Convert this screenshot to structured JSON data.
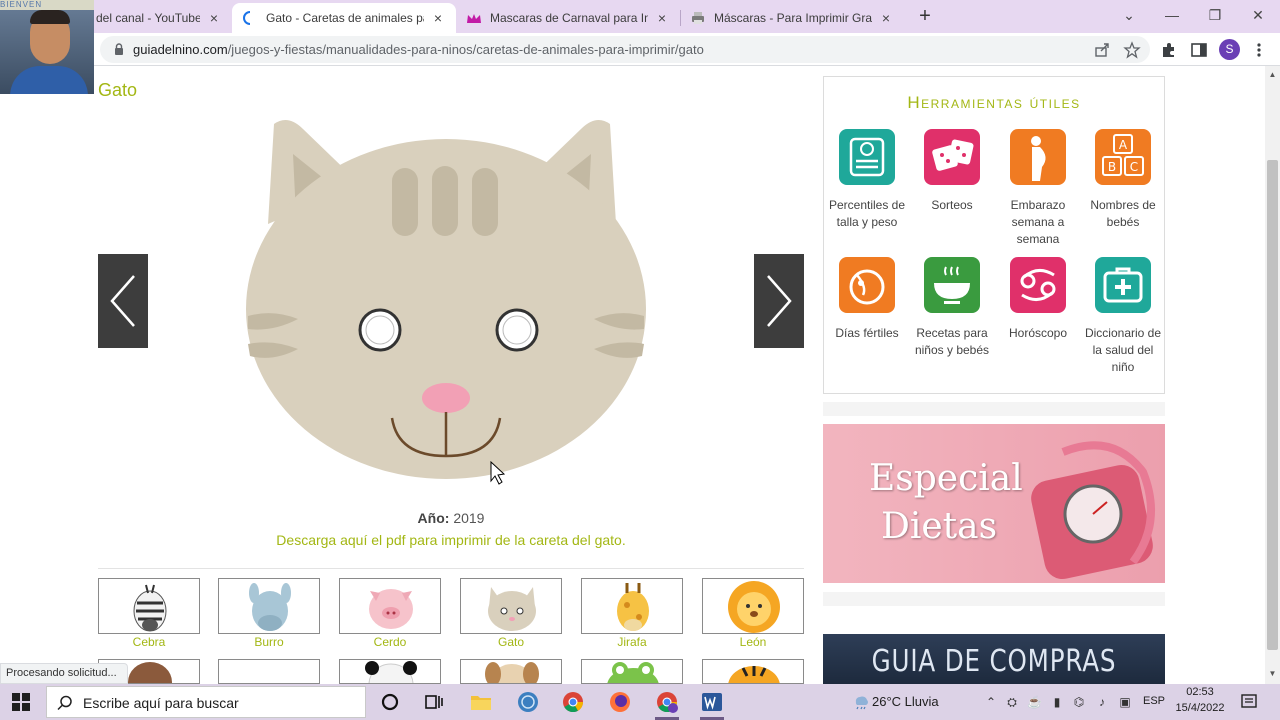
{
  "tabs": [
    {
      "title": "del canal - YouTube St",
      "active": false
    },
    {
      "title": "Gato - Caretas de animales para",
      "active": true
    },
    {
      "title": "Mascaras de Carnaval para Impri",
      "active": false
    },
    {
      "title": "Máscaras - Para Imprimir Gratis -",
      "active": false
    }
  ],
  "tab_close": "×",
  "new_tab": "+",
  "window_controls": {
    "minimize": "—",
    "restore": "❐",
    "close": "✕",
    "chevron": "⌄"
  },
  "address": {
    "domain": "guiadelnino.com",
    "path": "/juegos-y-fiestas/manualidades-para-ninos/caretas-de-animales-para-imprimir/gato"
  },
  "profile_initial": "S",
  "webcam_sign": "BIENVEN",
  "page": {
    "title": "Gato",
    "year_label": "Año:",
    "year_value": "2019",
    "download_text": "Descarga aquí el pdf para imprimir de la careta del gato.",
    "thumbnails": [
      "Cebra",
      "Burro",
      "Cerdo",
      "Gato",
      "Jirafa",
      "León"
    ]
  },
  "tools": {
    "title": "Herramientas útiles",
    "items": [
      {
        "label": "Percentiles de talla y peso",
        "icon": "scale-icon",
        "color": "#1fa89a"
      },
      {
        "label": "Sorteos",
        "icon": "dice-icon",
        "color": "#e0306a"
      },
      {
        "label": "Embarazo semana a semana",
        "icon": "pregnancy-icon",
        "color": "#f07b22"
      },
      {
        "label": "Nombres de bebés",
        "icon": "abc-blocks-icon",
        "color": "#f07b22"
      },
      {
        "label": "Días fértiles",
        "icon": "fertile-days-icon",
        "color": "#f07b22"
      },
      {
        "label": "Recetas para niños y bebés",
        "icon": "bowl-icon",
        "color": "#3a9b3f"
      },
      {
        "label": "Horóscopo",
        "icon": "cancer-sign-icon",
        "color": "#e0306a"
      },
      {
        "label": "Diccionario de la salud del niño",
        "icon": "first-aid-icon",
        "color": "#1fa89a"
      }
    ]
  },
  "banners": {
    "diets_line1": "Especial",
    "diets_line2": "Dietas",
    "compras": "GUIA DE COMPRAS"
  },
  "status_text": "Procesando solicitud...",
  "taskbar": {
    "search_placeholder": "Escribe aquí para buscar",
    "weather": "26°C  Lluvia",
    "lang": "ESP",
    "time": "02:53",
    "date": "15/4/2022"
  },
  "colors": {
    "accent_green": "#a3b714",
    "tab_bar": "#e7d8f1",
    "cat_fur": "#d9d0bd",
    "cat_stripe": "#c3b9a3"
  }
}
